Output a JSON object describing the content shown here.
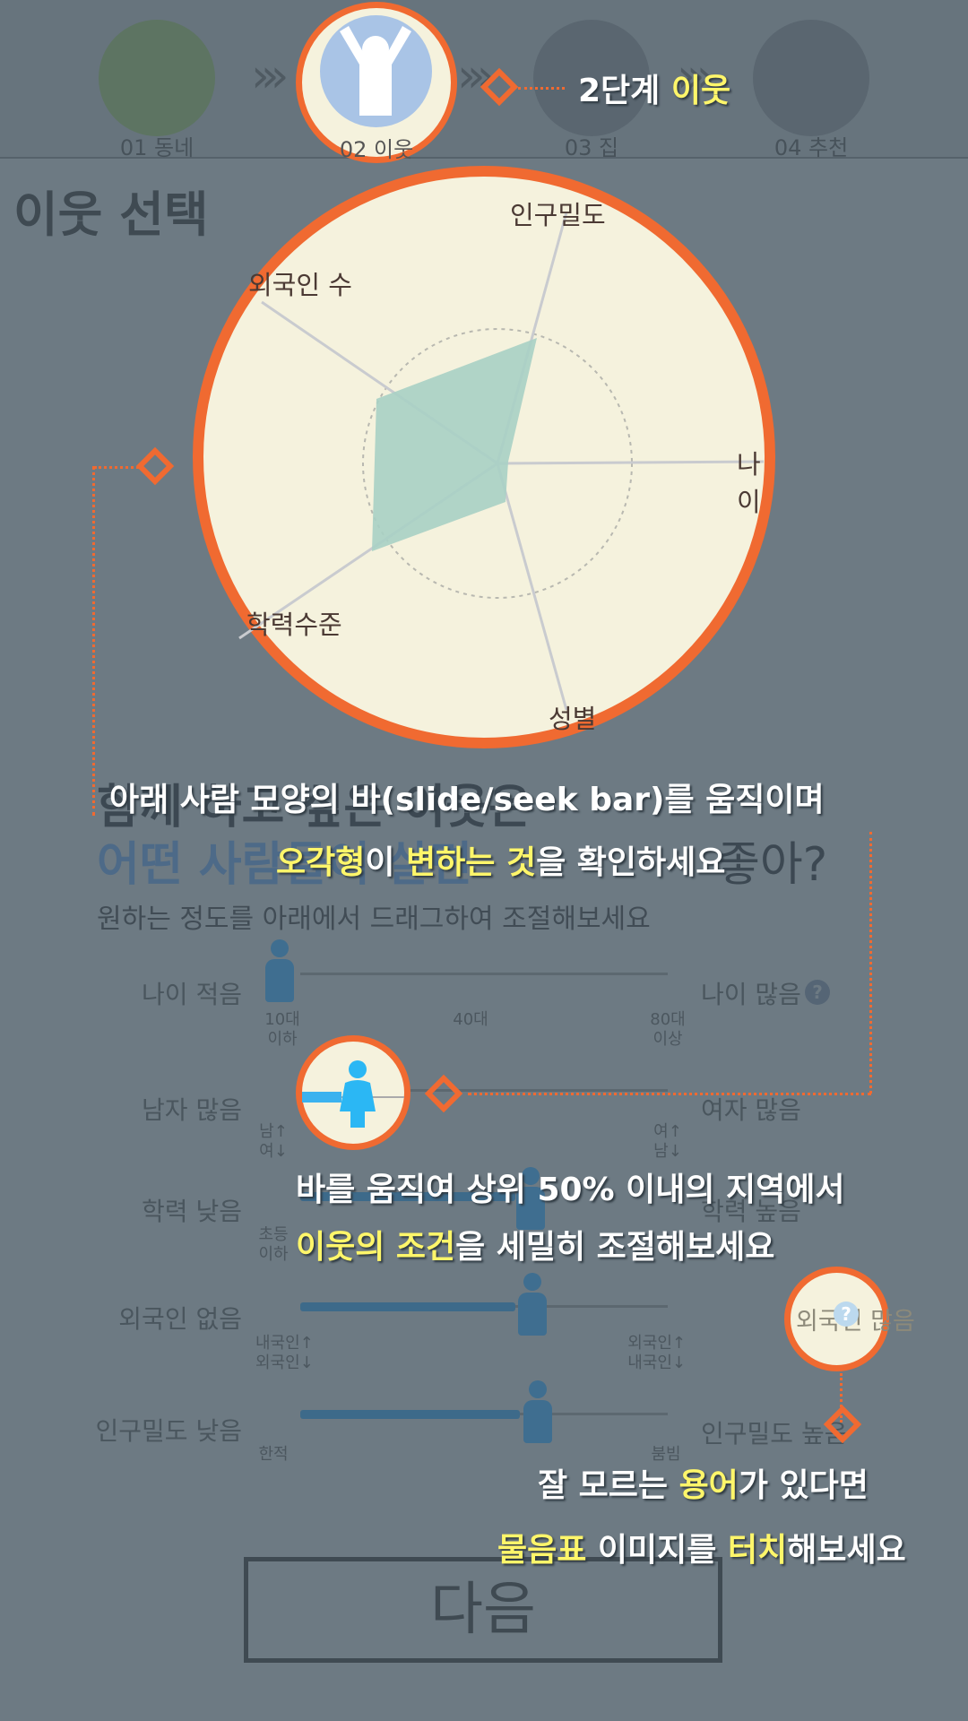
{
  "steps": [
    {
      "label": "01 동네"
    },
    {
      "label": "02 이웃"
    },
    {
      "label": "03 집"
    },
    {
      "label": "04 추천"
    }
  ],
  "page_title": "이웃 선택",
  "question": {
    "line1": "함께 하고 싶은 이웃은",
    "line2_highlight": "어떤 사람들이 살면",
    "line2_rest": "좋아?"
  },
  "instruction": "원하는 정도를 아래에서 드래그하여 조절해보세요",
  "radar": {
    "axes": [
      "인구밀도",
      "나이",
      "성별",
      "학력수준",
      "외국인 수"
    ],
    "fill_color": "#a8d0c4"
  },
  "sliders": [
    {
      "left": "나이 적음",
      "right": "나이 많음",
      "ticks": [
        "10대\n이하",
        "40대",
        "80대\n이상"
      ],
      "level": 0.0
    },
    {
      "left": "남자 많음",
      "right": "여자 많음",
      "ticks": [
        "남↑\n여↓",
        "여↑\n남↓"
      ],
      "level": 0.3
    },
    {
      "left": "학력 낮음",
      "right": "학력 높음",
      "ticks": [
        "초등\n이하"
      ],
      "level": 0.5
    },
    {
      "left": "외국인 없음",
      "right": "외국인 많음",
      "ticks": [
        "내국인↑\n외국인↓",
        "외국인↑\n내국인↓"
      ],
      "level": 0.5
    },
    {
      "left": "인구밀도 낮음",
      "right": "인구밀도 높음",
      "ticks": [
        "한적",
        "붐빔"
      ],
      "level": 0.5
    }
  ],
  "next_button": "다음",
  "tutorial": {
    "step_badge_prefix": "2단계",
    "step_badge_hl": "이웃",
    "radar_tip_line1": "아래 사람 모양의 바(slide/seek bar)를 움직이며",
    "radar_tip_line2_hl1": "오각형",
    "radar_tip_line2_mid": "이",
    "radar_tip_line2_hl2": "변하는 것",
    "radar_tip_line2_rest": "을 확인하세요",
    "slider_tip_line1": "바를 움직여 상위 50% 이내의 지역에서",
    "slider_tip_line2_hl": "이웃의 조건",
    "slider_tip_line2_rest": "을 세밀히 조절해보세요",
    "help_tip_line1_a": "잘 모르는",
    "help_tip_line1_hl": "용어",
    "help_tip_line1_b": "가 있다면",
    "help_tip_line2_hl1": "물음표",
    "help_tip_line2_mid": "이미지를",
    "help_tip_line2_hl2": "터치",
    "help_tip_line2_rest": "해보세요"
  },
  "colors": {
    "accent": "#f06a31",
    "highlight_text": "#fff66a",
    "spot_bg": "#f5f2dd"
  }
}
